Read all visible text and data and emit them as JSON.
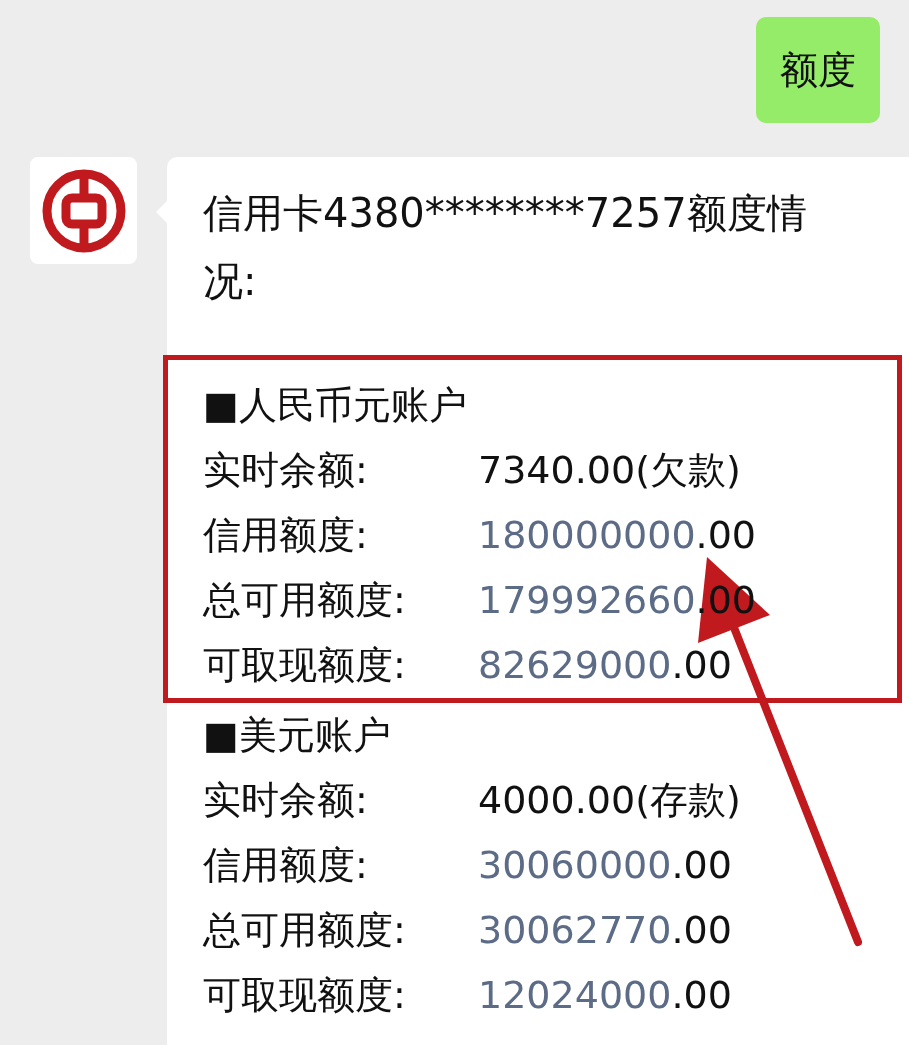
{
  "sent_message": {
    "text": "额度"
  },
  "reply": {
    "title": "信用卡4380********7257额度情况:",
    "sections": [
      {
        "header": "■人民币元账户",
        "highlighted": true,
        "rows": [
          {
            "label": "实时余额:",
            "kind": "plain",
            "value": "7340.00(欠款)"
          },
          {
            "label": "信用额度:",
            "kind": "link",
            "amount": "180000000",
            "decimals": ".00"
          },
          {
            "label": "总可用额度:",
            "kind": "link",
            "amount": "179992660",
            "decimals": ".00"
          },
          {
            "label": "可取现额度:",
            "kind": "link",
            "amount": "82629000",
            "decimals": ".00"
          }
        ]
      },
      {
        "header": "■美元账户",
        "highlighted": false,
        "rows": [
          {
            "label": "实时余额:",
            "kind": "plain",
            "value": "4000.00(存款)"
          },
          {
            "label": "信用额度:",
            "kind": "link",
            "amount": "30060000",
            "decimals": ".00"
          },
          {
            "label": "总可用额度:",
            "kind": "link",
            "amount": "30062770",
            "decimals": ".00"
          },
          {
            "label": "可取现额度:",
            "kind": "link",
            "amount": "12024000",
            "decimals": ".00"
          }
        ]
      }
    ]
  }
}
